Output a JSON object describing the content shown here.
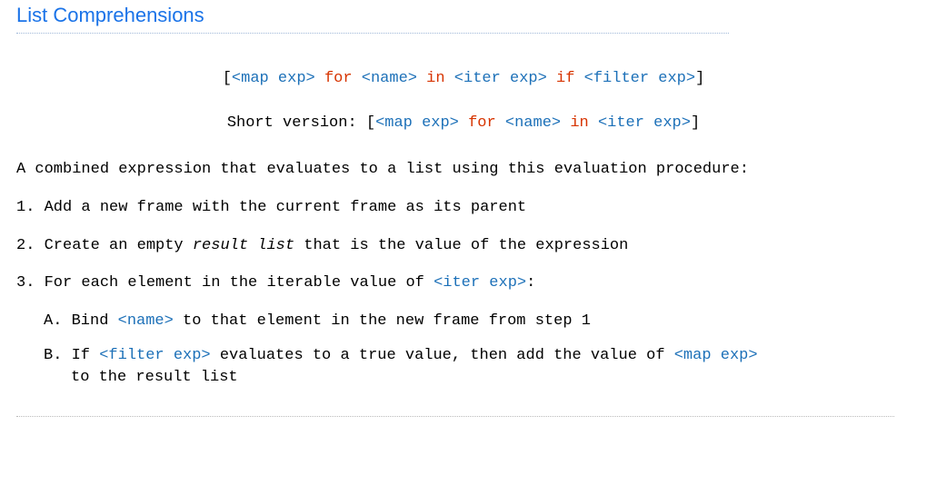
{
  "title": "List Comprehensions",
  "syntax": {
    "full": {
      "open": "[",
      "map": "<map exp>",
      "for": " for ",
      "name": "<name>",
      "in": " in ",
      "iter": "<iter exp>",
      "if": " if ",
      "filter": "<filter exp>",
      "close": "]"
    },
    "short_label": "Short version: ",
    "short": {
      "open": "[",
      "map": "<map exp>",
      "for": " for ",
      "name": "<name>",
      "in": " in ",
      "iter": "<iter exp>",
      "close": "]"
    }
  },
  "intro": "A combined expression that evaluates to a list using this evaluation procedure:",
  "steps": {
    "s1": "1. Add a new frame with the current frame as its parent",
    "s2a": "2. Create an empty ",
    "s2b": "result list",
    "s2c": " that is the value of the expression",
    "s3a": "3. For each element in the iterable value of ",
    "s3b": "<iter exp>",
    "s3c": ":",
    "aA": "A. Bind ",
    "aB": "<name>",
    "aC": " to that element in the new frame from step 1",
    "bA": "B. If ",
    "bB": "<filter exp>",
    "bC": " evaluates to a true value, then add the value of ",
    "bD": "<map exp>",
    "bE": "to the result list"
  }
}
